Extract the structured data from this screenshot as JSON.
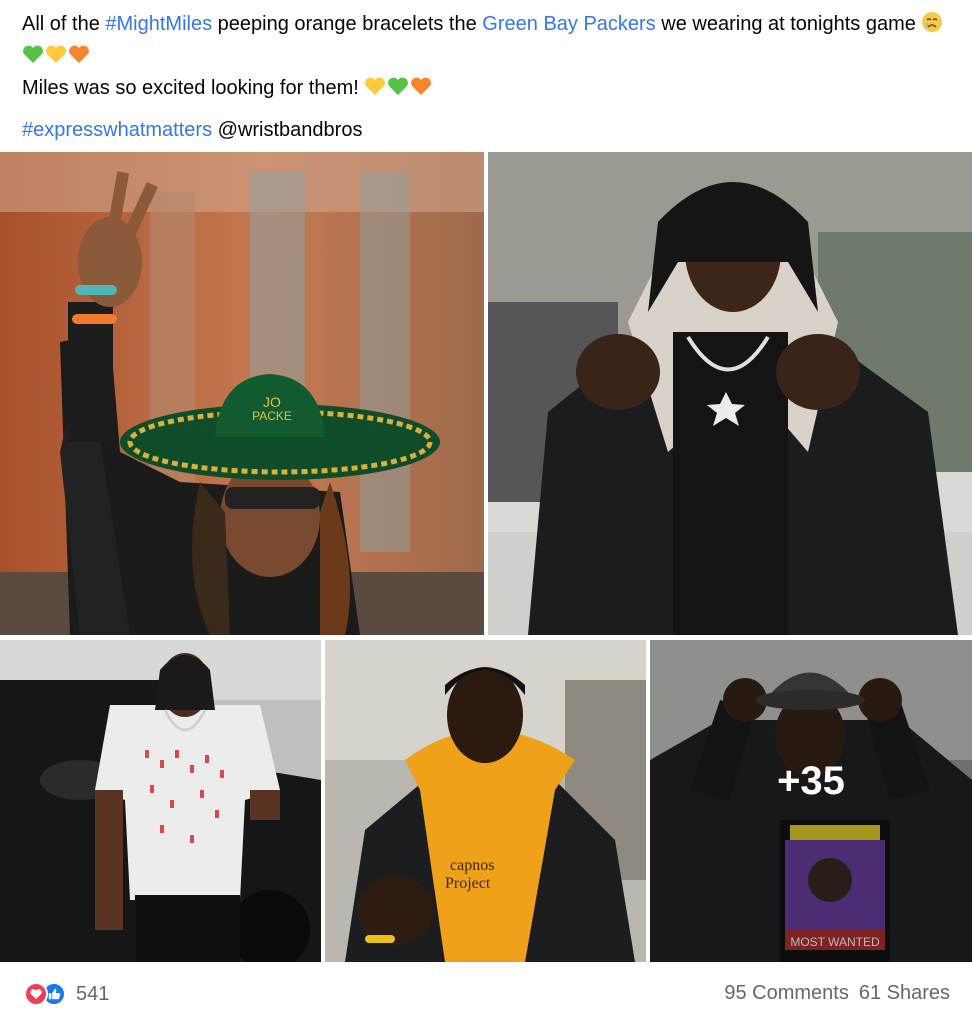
{
  "post": {
    "line1_a": "All of the ",
    "hashtag_might": "#MightMiles",
    "line1_b": " peeping orange bracelets the ",
    "team_link": "Green Bay Packers",
    "line1_c": " we wearing at tonights game ",
    "line2": "Miles was so excited looking for them! ",
    "hashtag_express": "#expresswhatmatters",
    "mention": " @wristbandbros"
  },
  "emojis": [
    "crying-face-icon",
    "green-heart-icon",
    "yellow-heart-icon",
    "orange-heart-icon"
  ],
  "colors": {
    "link": "#3578e5",
    "love": "#f33e58",
    "like": "#1877f2",
    "meta": "#65676b"
  },
  "gallery": {
    "more_label": "+35",
    "photo_count_shown": 5
  },
  "photo_text": {
    "hat_text": "JO\nPACKE",
    "hoodie_text": "capnos\nProject",
    "shirt_text": "MOST WANTED"
  },
  "footer": {
    "reaction_count": "541",
    "comments": "95 Comments",
    "shares": "61 Shares"
  }
}
